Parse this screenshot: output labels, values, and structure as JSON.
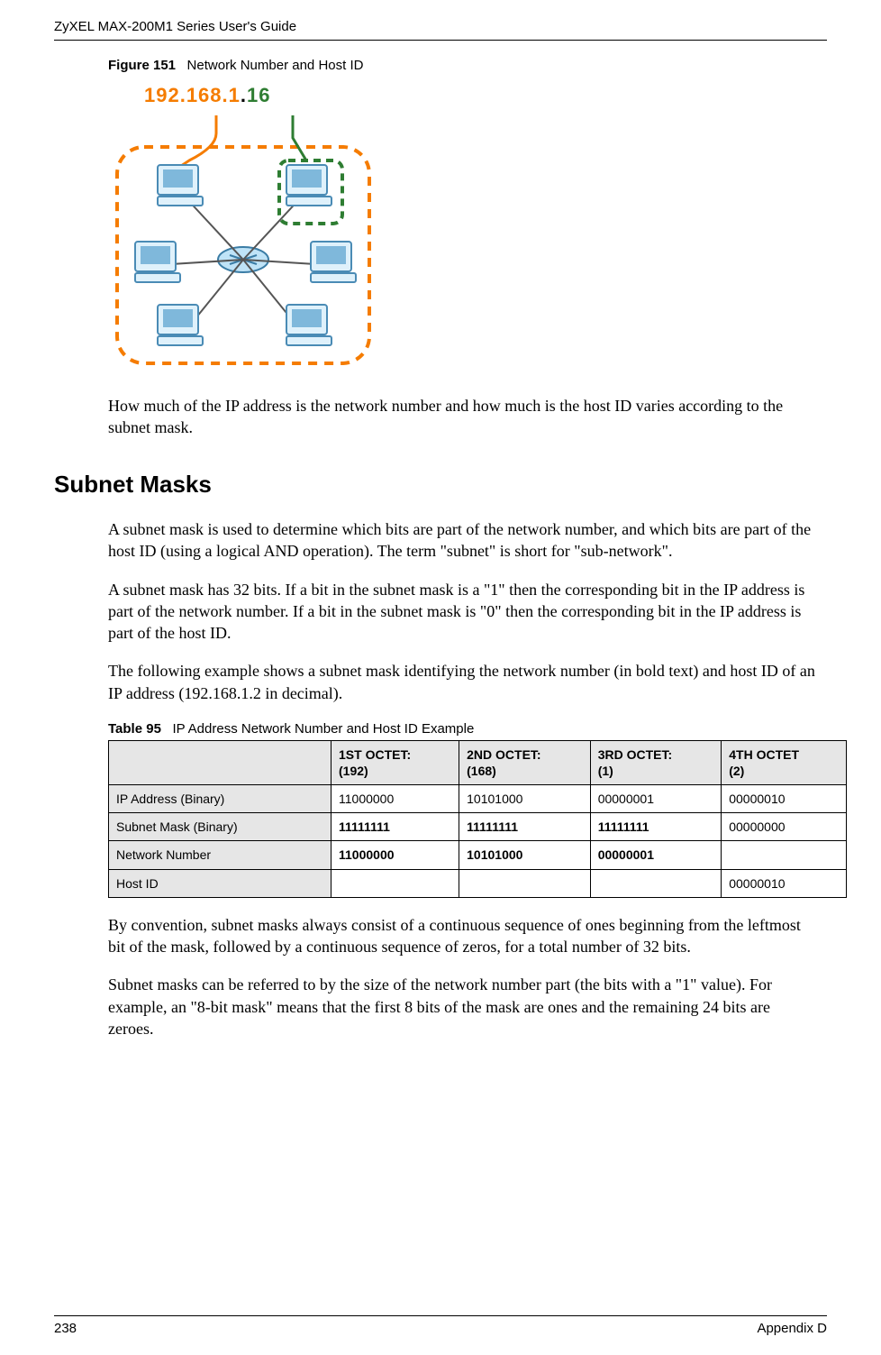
{
  "header": {
    "title": "ZyXEL MAX-200M1 Series User's Guide"
  },
  "figure": {
    "caption_label": "Figure 151",
    "caption_text": "Network Number and Host ID",
    "ip_net": "192.168.1",
    "ip_dot": ".",
    "ip_host": "16"
  },
  "paragraphs": {
    "p1": "How much of the IP address is the network number and how much is the host ID varies according to the subnet mask.",
    "h_subnet": "Subnet Masks",
    "p2": "A subnet mask is used to determine which bits are part of the network number, and which bits are part of the host ID (using a logical AND operation). The term \"subnet\" is short for \"sub-network\".",
    "p3": "A subnet mask has 32 bits. If a bit in the subnet mask is a \"1\" then the corresponding bit in the IP address is part of the network number. If a bit in the subnet mask is \"0\" then the corresponding bit in the IP address is part of the host ID.",
    "p4": "The following example shows a subnet mask identifying the network number (in bold text) and host ID of an IP address (192.168.1.2 in decimal).",
    "p5": "By convention, subnet masks always consist of a continuous sequence of ones beginning from the leftmost bit of the mask, followed by a continuous sequence of zeros, for a total number of 32 bits.",
    "p6": "Subnet masks can be referred to by the size of the network number part (the bits with a \"1\" value). For example, an \"8-bit mask\" means that the first 8 bits of the mask are ones and the remaining 24 bits are zeroes."
  },
  "table": {
    "caption_label": "Table 95",
    "caption_text": "IP Address Network Number and Host ID Example",
    "headers": {
      "blank": "",
      "c1": "1ST OCTET:\n(192)",
      "c2": "2ND OCTET:\n(168)",
      "c3": "3RD OCTET:\n(1)",
      "c4": "4TH OCTET\n(2)"
    },
    "rows": [
      {
        "label": "IP Address (Binary)",
        "c1": "11000000",
        "c2": "10101000",
        "c3": "00000001",
        "c4": "00000010",
        "bold": [
          false,
          false,
          false,
          false
        ]
      },
      {
        "label": "Subnet Mask (Binary)",
        "c1": "11111111",
        "c2": "11111111",
        "c3": "11111111",
        "c4": "00000000",
        "bold": [
          true,
          true,
          true,
          false
        ]
      },
      {
        "label": "Network Number",
        "c1": "11000000",
        "c2": "10101000",
        "c3": "00000001",
        "c4": "",
        "bold": [
          true,
          true,
          true,
          false
        ]
      },
      {
        "label": "Host ID",
        "c1": "",
        "c2": "",
        "c3": "",
        "c4": "00000010",
        "bold": [
          false,
          false,
          false,
          false
        ]
      }
    ]
  },
  "footer": {
    "page": "238",
    "section": "Appendix D"
  }
}
